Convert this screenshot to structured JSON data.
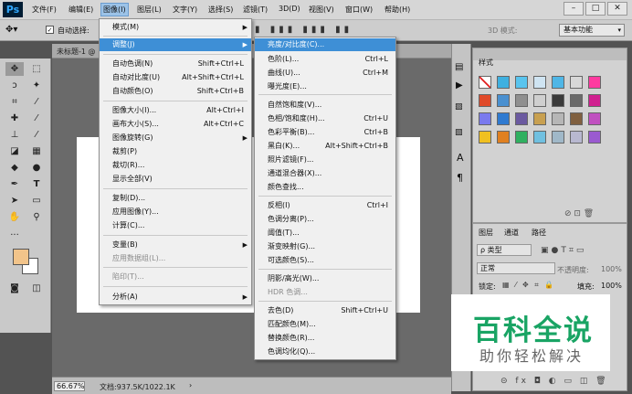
{
  "app": {
    "logo": "Ps"
  },
  "menubar": {
    "items": [
      "文件(F)",
      "编辑(E)",
      "图像(I)",
      "图层(L)",
      "文字(Y)",
      "选择(S)",
      "滤镜(T)",
      "3D(D)",
      "视图(V)",
      "窗口(W)",
      "帮助(H)"
    ],
    "active_index": 2,
    "window_controls": [
      "–",
      "□",
      "✕"
    ]
  },
  "optionsbar": {
    "auto_select_label": "自动选择:",
    "mode_3d_label": "3D 模式:",
    "workspace_value": "基本功能"
  },
  "document": {
    "tab_label": "未标题-1 @",
    "zoom": "66.67%",
    "doc_info": "文档:937.5K/1022.1K"
  },
  "image_menu": {
    "items": [
      {
        "label": "模式(M)",
        "shortcut": "",
        "submenu": true,
        "disabled": false,
        "highlighted": false
      },
      {
        "label": "调整(J)",
        "shortcut": "",
        "submenu": true,
        "disabled": false,
        "highlighted": true
      },
      {
        "label": "自动色调(N)",
        "shortcut": "Shift+Ctrl+L",
        "submenu": false,
        "disabled": false,
        "highlighted": false
      },
      {
        "label": "自动对比度(U)",
        "shortcut": "Alt+Shift+Ctrl+L",
        "submenu": false,
        "disabled": false,
        "highlighted": false
      },
      {
        "label": "自动颜色(O)",
        "shortcut": "Shift+Ctrl+B",
        "submenu": false,
        "disabled": false,
        "highlighted": false
      },
      {
        "label": "图像大小(I)...",
        "shortcut": "Alt+Ctrl+I",
        "submenu": false,
        "disabled": false,
        "highlighted": false
      },
      {
        "label": "画布大小(S)...",
        "shortcut": "Alt+Ctrl+C",
        "submenu": false,
        "disabled": false,
        "highlighted": false
      },
      {
        "label": "图像旋转(G)",
        "shortcut": "",
        "submenu": true,
        "disabled": false,
        "highlighted": false
      },
      {
        "label": "裁剪(P)",
        "shortcut": "",
        "submenu": false,
        "disabled": false,
        "highlighted": false
      },
      {
        "label": "裁切(R)...",
        "shortcut": "",
        "submenu": false,
        "disabled": false,
        "highlighted": false
      },
      {
        "label": "显示全部(V)",
        "shortcut": "",
        "submenu": false,
        "disabled": false,
        "highlighted": false
      },
      {
        "label": "复制(D)...",
        "shortcut": "",
        "submenu": false,
        "disabled": false,
        "highlighted": false
      },
      {
        "label": "应用图像(Y)...",
        "shortcut": "",
        "submenu": false,
        "disabled": false,
        "highlighted": false
      },
      {
        "label": "计算(C)...",
        "shortcut": "",
        "submenu": false,
        "disabled": false,
        "highlighted": false
      },
      {
        "label": "变量(B)",
        "shortcut": "",
        "submenu": true,
        "disabled": false,
        "highlighted": false
      },
      {
        "label": "应用数据组(L)...",
        "shortcut": "",
        "submenu": false,
        "disabled": true,
        "highlighted": false
      },
      {
        "label": "陷印(T)...",
        "shortcut": "",
        "submenu": false,
        "disabled": true,
        "highlighted": false
      },
      {
        "label": "分析(A)",
        "shortcut": "",
        "submenu": true,
        "disabled": false,
        "highlighted": false
      }
    ]
  },
  "adjust_menu": {
    "items": [
      {
        "label": "亮度/对比度(C)...",
        "shortcut": "",
        "disabled": false,
        "highlighted": true
      },
      {
        "label": "色阶(L)...",
        "shortcut": "Ctrl+L",
        "disabled": false,
        "highlighted": false
      },
      {
        "label": "曲线(U)...",
        "shortcut": "Ctrl+M",
        "disabled": false,
        "highlighted": false
      },
      {
        "label": "曝光度(E)...",
        "shortcut": "",
        "disabled": false,
        "highlighted": false
      },
      {
        "label": "自然饱和度(V)...",
        "shortcut": "",
        "disabled": false,
        "highlighted": false
      },
      {
        "label": "色相/饱和度(H)...",
        "shortcut": "Ctrl+U",
        "disabled": false,
        "highlighted": false
      },
      {
        "label": "色彩平衡(B)...",
        "shortcut": "Ctrl+B",
        "disabled": false,
        "highlighted": false
      },
      {
        "label": "黑白(K)...",
        "shortcut": "Alt+Shift+Ctrl+B",
        "disabled": false,
        "highlighted": false
      },
      {
        "label": "照片滤镜(F)...",
        "shortcut": "",
        "disabled": false,
        "highlighted": false
      },
      {
        "label": "通道混合器(X)...",
        "shortcut": "",
        "disabled": false,
        "highlighted": false
      },
      {
        "label": "颜色查找...",
        "shortcut": "",
        "disabled": false,
        "highlighted": false
      },
      {
        "label": "反相(I)",
        "shortcut": "Ctrl+I",
        "disabled": false,
        "highlighted": false
      },
      {
        "label": "色调分离(P)...",
        "shortcut": "",
        "disabled": false,
        "highlighted": false
      },
      {
        "label": "阈值(T)...",
        "shortcut": "",
        "disabled": false,
        "highlighted": false
      },
      {
        "label": "渐变映射(G)...",
        "shortcut": "",
        "disabled": false,
        "highlighted": false
      },
      {
        "label": "可选颜色(S)...",
        "shortcut": "",
        "disabled": false,
        "highlighted": false
      },
      {
        "label": "阴影/高光(W)...",
        "shortcut": "",
        "disabled": false,
        "highlighted": false
      },
      {
        "label": "HDR 色调...",
        "shortcut": "",
        "disabled": true,
        "highlighted": false
      },
      {
        "label": "去色(D)",
        "shortcut": "Shift+Ctrl+U",
        "disabled": false,
        "highlighted": false
      },
      {
        "label": "匹配颜色(M)...",
        "shortcut": "",
        "disabled": false,
        "highlighted": false
      },
      {
        "label": "替换颜色(R)...",
        "shortcut": "",
        "disabled": false,
        "highlighted": false
      },
      {
        "label": "色调均化(Q)...",
        "shortcut": "",
        "disabled": false,
        "highlighted": false
      }
    ]
  },
  "styles_panel": {
    "tab": "样式",
    "swatch_colors": [
      "#ffffff",
      "#3fb0e0",
      "#59c4ee",
      "#cfe4f2",
      "#4fb6e6",
      "#d7d7d7",
      "#ff3aa0",
      "#e04a2a",
      "#4a90d0",
      "#8f8f8f",
      "#cfcfcf",
      "#3a3a3a",
      "#6a6a6a",
      "#d02090",
      "#7a7aee",
      "#2f7ad0",
      "#6b5aa0",
      "#c8a050",
      "#b6b6b6",
      "#806040",
      "#c050c0",
      "#f0c020",
      "#e08020",
      "#30b060",
      "#70c0e0",
      "#a0b8c8",
      "#b8b8d0",
      "#9a5ad0"
    ]
  },
  "layers_panel": {
    "tabs": [
      "图层",
      "通道",
      "路径"
    ],
    "kind_label": "ρ 类型",
    "blend_mode": "正常",
    "opacity_label": "不透明度:",
    "opacity_value": "100%",
    "lock_label": "锁定:",
    "fill_label": "填充:",
    "fill_value": "100%"
  },
  "watermark": {
    "title": "百科全说",
    "subtitle": "助你轻松解决"
  },
  "colors": {
    "accent": "#3e8fd6",
    "brand_green": "#19a464",
    "foreground_swatch": "#f2c48a",
    "background_swatch": "#ffffff"
  }
}
